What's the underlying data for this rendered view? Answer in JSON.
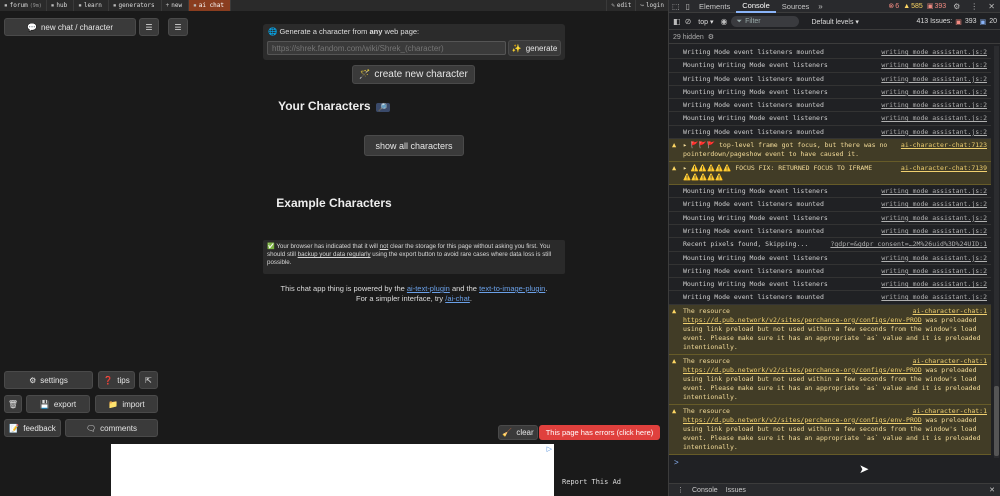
{
  "nav": {
    "items": [
      {
        "glyph": "▪",
        "label": "forum",
        "sub": "(9m)"
      },
      {
        "glyph": "▪",
        "label": "hub",
        "sub": ""
      },
      {
        "glyph": "▪",
        "label": "learn",
        "sub": ""
      },
      {
        "glyph": "▪",
        "label": "generators",
        "sub": ""
      },
      {
        "glyph": "+",
        "label": "new",
        "sub": ""
      },
      {
        "glyph": "▪",
        "label": "ai chat",
        "sub": ""
      }
    ],
    "edit": "edit",
    "login": "login"
  },
  "app": {
    "new_chat": "new chat / character",
    "menu_glyph": "☰",
    "generator_label_pre": "Generate a character from",
    "generator_label_bold": "any",
    "generator_label_post": "web page:",
    "generator_placeholder": "https://shrek.fandom.com/wiki/Shrek_(character)",
    "generate": "generate",
    "create_new": "create new character",
    "your_characters": "Your Characters",
    "show_all": "show all characters",
    "example_characters": "Example Characters",
    "notice_pre": "Your browser has indicated that it will",
    "notice_not": "not",
    "notice_mid": "clear the storage for this page without asking you first. You should still",
    "notice_backup": "backup your data regularly",
    "notice_post": "using the export button to avoid rare cases where data loss is still possible.",
    "powered_pre": "This chat app thing is powered by the",
    "powered_link1": "ai-text-plugin",
    "powered_and": "and the",
    "powered_link2": "text-to-image-plugin",
    "simpler_pre": "For a simpler interface, try",
    "simpler_link": "/ai-chat",
    "settings": "settings",
    "tips": "tips",
    "export": "export",
    "import": "import",
    "feedback": "feedback",
    "comments": "comments",
    "clear": "clear",
    "errors": "This page has errors (click here)",
    "report_ad": "Report This Ad"
  },
  "devtools": {
    "tabs": [
      "Elements",
      "Console",
      "Sources"
    ],
    "active_tab": "Console",
    "errors": "6",
    "warnings": "585",
    "info": "393",
    "context": "top",
    "filter_placeholder": "Filter",
    "levels": "Default levels",
    "issues_label": "413 Issues:",
    "issues_err": "393",
    "issues_info": "20",
    "hidden": "29 hidden",
    "logs": [
      {
        "type": "log",
        "text": "Writing Mode event listeners mounted",
        "src": "writing_mode_assistant.js:2"
      },
      {
        "type": "log",
        "text": "Mounting Writing Mode event listeners",
        "src": "writing_mode_assistant.js:2"
      },
      {
        "type": "log",
        "text": "Writing Mode event listeners mounted",
        "src": "writing_mode_assistant.js:2"
      },
      {
        "type": "log",
        "text": "Mounting Writing Mode event listeners",
        "src": "writing_mode_assistant.js:2"
      },
      {
        "type": "log",
        "text": "Writing Mode event listeners mounted",
        "src": "writing_mode_assistant.js:2"
      },
      {
        "type": "log",
        "text": "Mounting Writing Mode event listeners",
        "src": "writing_mode_assistant.js:2"
      },
      {
        "type": "log",
        "text": "Writing Mode event listeners mounted",
        "src": "writing_mode_assistant.js:2"
      },
      {
        "type": "warn",
        "text": "▸ 🚩🚩🚩 top-level frame got focus, but there was no pointerdown/pageshow event to have caused it.",
        "src": "ai-character-chat:7123"
      },
      {
        "type": "warn",
        "text": "▸ ⚠️⚠️⚠️⚠️⚠️ FOCUS FIX: RETURNED FOCUS TO IFRAME ⚠️⚠️⚠️⚠️⚠️",
        "src": "ai-character-chat:7139"
      },
      {
        "type": "log",
        "text": "Mounting Writing Mode event listeners",
        "src": "writing_mode_assistant.js:2"
      },
      {
        "type": "log",
        "text": "Writing Mode event listeners mounted",
        "src": "writing_mode_assistant.js:2"
      },
      {
        "type": "log",
        "text": "Mounting Writing Mode event listeners",
        "src": "writing_mode_assistant.js:2"
      },
      {
        "type": "log",
        "text": "Writing Mode event listeners mounted",
        "src": "writing_mode_assistant.js:2"
      },
      {
        "type": "log",
        "text": "Recent pixels found, Skipping...",
        "src": "?gdpr=&gdpr_consent=…2M%26uid%3D%24UID:1"
      },
      {
        "type": "log",
        "text": "Mounting Writing Mode event listeners",
        "src": "writing_mode_assistant.js:2"
      },
      {
        "type": "log",
        "text": "Writing Mode event listeners mounted",
        "src": "writing_mode_assistant.js:2"
      },
      {
        "type": "log",
        "text": "Mounting Writing Mode event listeners",
        "src": "writing_mode_assistant.js:2"
      },
      {
        "type": "log",
        "text": "Writing Mode event listeners mounted",
        "src": "writing_mode_assistant.js:2"
      },
      {
        "type": "res",
        "pre": "The resource",
        "url": "https://d.pub.network/v2/sites/perchance-org/configs/env-PROD",
        "post": "was preloaded using link preload but not used within a few seconds from the window's load event. Please make sure it has an appropriate `as` value and it is preloaded intentionally.",
        "src": "ai-character-chat:1"
      },
      {
        "type": "res",
        "pre": "The resource",
        "url": "https://d.pub.network/v2/sites/perchance-org/configs/env-PROD",
        "post": "was preloaded using link preload but not used within a few seconds from the window's load event. Please make sure it has an appropriate `as` value and it is preloaded intentionally.",
        "src": "ai-character-chat:1"
      },
      {
        "type": "res",
        "pre": "The resource",
        "url": "https://d.pub.network/v2/sites/perchance-org/configs/env-PROD",
        "post": "was preloaded using link preload but not used within a few seconds from the window's load event. Please make sure it has an appropriate `as` value and it is preloaded intentionally.",
        "src": "ai-character-chat:1"
      }
    ],
    "prompt": ">",
    "drawer_tabs": [
      "Console",
      "Issues"
    ]
  }
}
